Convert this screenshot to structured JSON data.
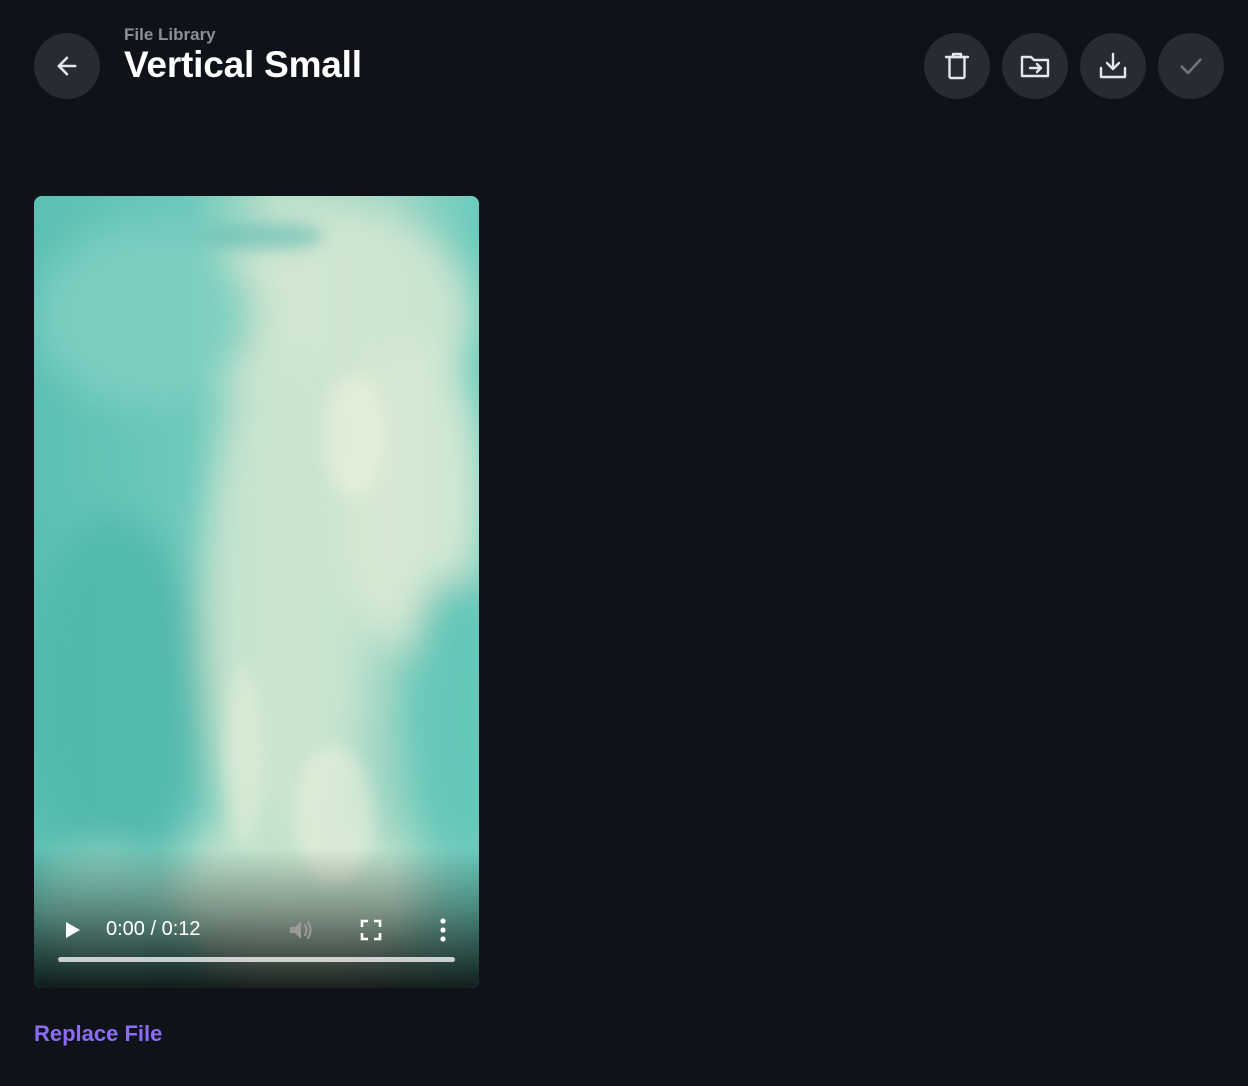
{
  "header": {
    "breadcrumb": "File Library",
    "title": "Vertical Small",
    "back_icon": "arrow-left-icon"
  },
  "toolbar": {
    "delete_icon": "trash-icon",
    "move_icon": "folder-move-icon",
    "download_icon": "download-icon",
    "confirm_icon": "check-icon"
  },
  "video": {
    "current_time": "0:00",
    "duration": "0:12",
    "time_display": "0:00 / 0:12",
    "progress_fraction": 0,
    "icons": [
      "play-icon",
      "volume-icon",
      "fullscreen-icon",
      "more-vertical-icon"
    ]
  },
  "actions": {
    "replace_label": "Replace File"
  },
  "colors": {
    "background": "#0f1218",
    "button_bg": "#272b33",
    "accent": "#8b6cf6",
    "muted_text": "#8a8f98"
  }
}
